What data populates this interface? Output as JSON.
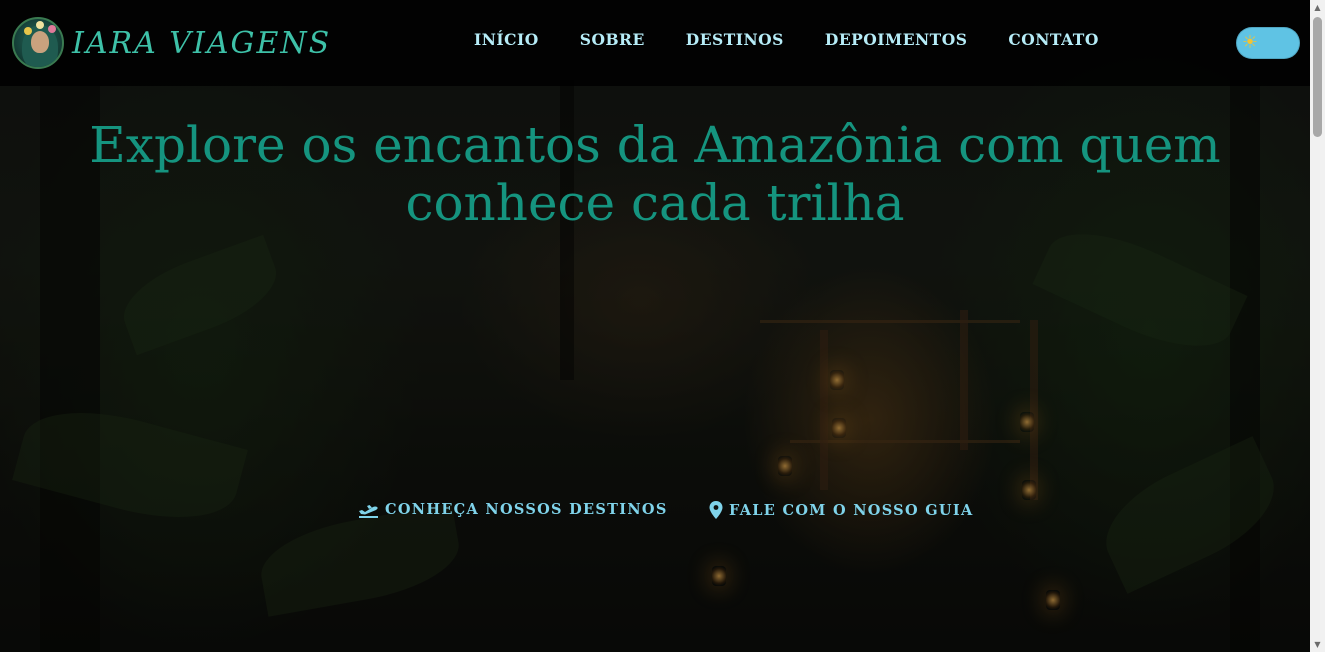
{
  "brand": {
    "name": "IARA VIAGENS"
  },
  "nav": {
    "items": [
      {
        "label": "INÍCIO"
      },
      {
        "label": "SOBRE"
      },
      {
        "label": "DESTINOS"
      },
      {
        "label": "DEPOIMENTOS"
      },
      {
        "label": "CONTATO"
      }
    ]
  },
  "theme_toggle": {
    "icon": "sun-icon",
    "state": "light"
  },
  "hero": {
    "headline_line1": "Explore os encantos da Amazônia com quem",
    "headline_line2": "conhece cada trilha",
    "cta_destinations": {
      "label": "CONHEÇA NOSSOS DESTINOS",
      "icon": "plane-departure-icon"
    },
    "cta_guide": {
      "label": "FALE COM O NOSSO GUIA",
      "icon": "map-pin-icon"
    }
  },
  "colors": {
    "accent": "#15947f",
    "brand": "#3ec1a8",
    "nav_text": "#b6ecf7",
    "cta_text": "#7fd3ea",
    "toggle_bg": "#5fc3e4"
  }
}
